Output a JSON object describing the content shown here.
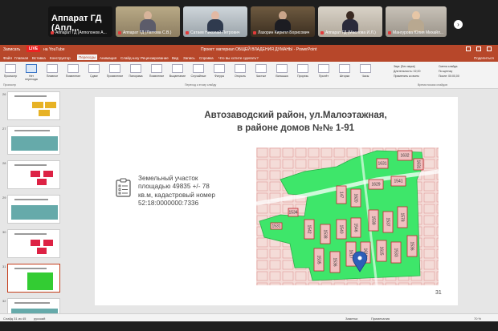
{
  "participants": [
    {
      "label": "Аппарат ГД (Апл...",
      "big_label": "Аппарат ГД (Апл..."
    },
    {
      "label": "Аппарат ГД (Апполонов А..."
    },
    {
      "label": "Аппарат ГД (Латгова С.В.)"
    },
    {
      "label": "Сатаев Николай Петрович"
    },
    {
      "label": "Аппарат ГД (Маслова И.Л.)"
    },
    {
      "label": "Мангурова Юлия Михайл..."
    }
  ],
  "conference": {
    "next_icon": "chevron-right-icon"
  },
  "ppt": {
    "window_title": "Проект: материал ОБЩЕЙ ВЛАДЕНИЯ ДУМАНЫ - PowerPoint",
    "live_badge": "LIVE",
    "stream_target": "на YouTube",
    "quick_access": "Записать",
    "menu": [
      "Файл",
      "Главная",
      "Вставка",
      "Конструктор",
      "Переходы",
      "Анимация",
      "Слайд-шоу",
      "Рецензирование",
      "Вид",
      "Запись",
      "Справка",
      "Что вы хотите сделать?"
    ],
    "active_menu": "Переходы",
    "share_label": "Поделиться",
    "ribbon_buttons": [
      "Просмотр",
      "Нет перехода",
      "Плавное",
      "Появление",
      "Сдвиг",
      "Проявление",
      "Панорама",
      "Появление",
      "Выцветание",
      "Случайные",
      "Фигура",
      "Открыть",
      "Частые",
      "Вспышка",
      "Прорезь",
      "Пролёт",
      "Шторки",
      "Часы",
      "Вырезание",
      "Скорость"
    ],
    "ribbon_groups": [
      "Просмотр",
      "Переход к этому слайду",
      "Время показа слайдов"
    ],
    "right_options": [
      "Звук:  [Без звука]",
      "Длительность: 02,00",
      "Применить ко всем",
      "Смена слайда",
      "По щелчку",
      "После: 00:00,00"
    ],
    "status_left": "Слайд 31 из 45",
    "status_lang": "русский",
    "status_notes": "Заметки",
    "status_comments": "Примечания",
    "status_zoom": "70 %"
  },
  "slide": {
    "title_line1": "Автозаводский район, ул.Малоэтажная,",
    "title_line2": "в районе домов №№ 1-91",
    "desc_lines": [
      "Земельный участок",
      "площадью 49835 +/- 78",
      "кв.м, кадастровый номер",
      "52:18:0000000:7336"
    ],
    "page_number": "31",
    "clipboard_icon": "clipboard-icon",
    "map_labels": [
      "147",
      "1620",
      "1629",
      "1541",
      "1542",
      "1538",
      "1540",
      "1546",
      "1539",
      "1537",
      "1578",
      "1536",
      "1535",
      "1536",
      "1617",
      "1616",
      "1615",
      "1533",
      "1534",
      "1531",
      "1632",
      "1631",
      "1631",
      "1624",
      "1626"
    ],
    "map_colors": {
      "parcel": "#3ee66a",
      "lot": "#f0c0c0",
      "lot_border": "#c0282e",
      "marker": "#2e5fb8"
    }
  },
  "thumb_numbers": [
    "26",
    "27",
    "28",
    "29",
    "30",
    "31",
    "32",
    "33"
  ]
}
